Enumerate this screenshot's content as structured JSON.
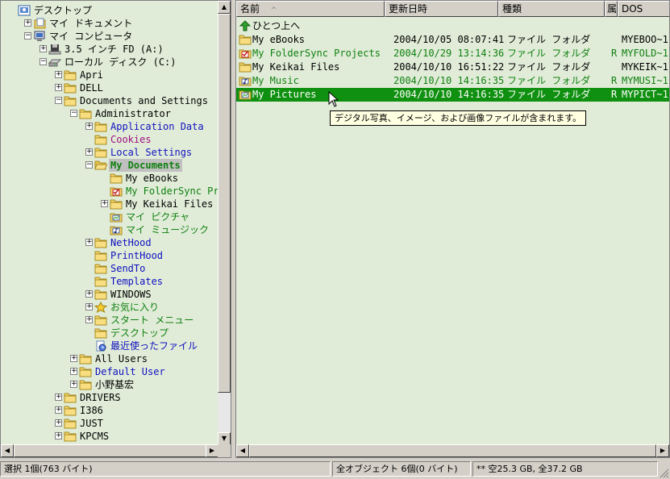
{
  "tree": {
    "items": [
      {
        "label": "デスクトップ",
        "depth": 0,
        "expander": "",
        "icon": "desktop-icon",
        "color": "black"
      },
      {
        "label": "マイ ドキュメント",
        "depth": 1,
        "expander": "+",
        "icon": "my-documents-icon",
        "color": "black"
      },
      {
        "label": "マイ コンピュータ",
        "depth": 1,
        "expander": "-",
        "icon": "my-computer-icon",
        "color": "black"
      },
      {
        "label": "3.5 インチ FD (A:)",
        "depth": 2,
        "expander": "+",
        "icon": "floppy-drive-icon",
        "color": "black"
      },
      {
        "label": "ローカル ディスク (C:)",
        "depth": 2,
        "expander": "-",
        "icon": "hard-disk-icon",
        "color": "black"
      },
      {
        "label": "Apri",
        "depth": 3,
        "expander": "+",
        "icon": "folder-icon",
        "color": "black"
      },
      {
        "label": "DELL",
        "depth": 3,
        "expander": "+",
        "icon": "folder-icon",
        "color": "black"
      },
      {
        "label": "Documents and Settings",
        "depth": 3,
        "expander": "-",
        "icon": "folder-icon",
        "color": "black"
      },
      {
        "label": "Administrator",
        "depth": 4,
        "expander": "-",
        "icon": "folder-icon",
        "color": "black"
      },
      {
        "label": "Application Data",
        "depth": 5,
        "expander": "+",
        "icon": "folder-icon",
        "color": "blue"
      },
      {
        "label": "Cookies",
        "depth": 5,
        "expander": "",
        "icon": "folder-icon",
        "color": "purple"
      },
      {
        "label": "Local Settings",
        "depth": 5,
        "expander": "+",
        "icon": "folder-icon",
        "color": "blue"
      },
      {
        "label": "My Documents",
        "depth": 5,
        "expander": "-",
        "icon": "open-folder-icon",
        "color": "green",
        "selected": true
      },
      {
        "label": "My eBooks",
        "depth": 6,
        "expander": "",
        "icon": "folder-icon",
        "color": "black"
      },
      {
        "label": "My FolderSync Projects",
        "depth": 6,
        "expander": "",
        "icon": "foldersync-folder-icon",
        "color": "green"
      },
      {
        "label": "My Keikai Files",
        "depth": 6,
        "expander": "+",
        "icon": "folder-icon",
        "color": "black"
      },
      {
        "label": "マイ ピクチャ",
        "depth": 6,
        "expander": "",
        "icon": "my-pictures-icon",
        "color": "green"
      },
      {
        "label": "マイ ミュージック",
        "depth": 6,
        "expander": "",
        "icon": "my-music-icon",
        "color": "green"
      },
      {
        "label": "NetHood",
        "depth": 5,
        "expander": "+",
        "icon": "folder-icon",
        "color": "blue"
      },
      {
        "label": "PrintHood",
        "depth": 5,
        "expander": "",
        "icon": "folder-icon",
        "color": "blue"
      },
      {
        "label": "SendTo",
        "depth": 5,
        "expander": "",
        "icon": "folder-icon",
        "color": "blue"
      },
      {
        "label": "Templates",
        "depth": 5,
        "expander": "",
        "icon": "folder-icon",
        "color": "blue"
      },
      {
        "label": "WINDOWS",
        "depth": 5,
        "expander": "+",
        "icon": "folder-icon",
        "color": "black"
      },
      {
        "label": "お気に入り",
        "depth": 5,
        "expander": "+",
        "icon": "favorites-star-icon",
        "color": "green"
      },
      {
        "label": "スタート メニュー",
        "depth": 5,
        "expander": "+",
        "icon": "folder-icon",
        "color": "green"
      },
      {
        "label": "デスクトップ",
        "depth": 5,
        "expander": "",
        "icon": "folder-icon",
        "color": "green"
      },
      {
        "label": "最近使ったファイル",
        "depth": 5,
        "expander": "",
        "icon": "recent-files-icon",
        "color": "blue"
      },
      {
        "label": "All Users",
        "depth": 4,
        "expander": "+",
        "icon": "folder-icon",
        "color": "black"
      },
      {
        "label": "Default User",
        "depth": 4,
        "expander": "+",
        "icon": "folder-icon",
        "color": "blue"
      },
      {
        "label": "小野基宏",
        "depth": 4,
        "expander": "+",
        "icon": "folder-icon",
        "color": "black"
      },
      {
        "label": "DRIVERS",
        "depth": 3,
        "expander": "+",
        "icon": "folder-icon",
        "color": "black"
      },
      {
        "label": "I386",
        "depth": 3,
        "expander": "+",
        "icon": "folder-icon",
        "color": "black"
      },
      {
        "label": "JUST",
        "depth": 3,
        "expander": "+",
        "icon": "folder-icon",
        "color": "black"
      },
      {
        "label": "KPCMS",
        "depth": 3,
        "expander": "+",
        "icon": "folder-icon",
        "color": "black"
      }
    ]
  },
  "list": {
    "columns": [
      "名前",
      "更新日時",
      "種類",
      "属",
      "DOS"
    ],
    "sort_indicator": "^",
    "rows": [
      {
        "name": "ひとつ上へ",
        "date": "",
        "type": "",
        "attr": "",
        "dos": "",
        "icon": "up-arrow-icon",
        "color": "black"
      },
      {
        "name": "My eBooks",
        "date": "2004/10/05 08:07:41",
        "type": "ファイル フォルダ",
        "attr": "",
        "dos": "MYEBOO~1",
        "icon": "folder-icon",
        "color": "black"
      },
      {
        "name": "My FolderSync Projects",
        "date": "2004/10/29 13:14:36",
        "type": "ファイル フォルダ",
        "attr": "R",
        "dos": "MYFOLD~1",
        "icon": "foldersync-folder-icon",
        "color": "green"
      },
      {
        "name": "My Keikai Files",
        "date": "2004/10/10 16:51:22",
        "type": "ファイル フォルダ",
        "attr": "",
        "dos": "MYKEIK~1",
        "icon": "folder-icon",
        "color": "black"
      },
      {
        "name": "My Music",
        "date": "2004/10/10 14:16:35",
        "type": "ファイル フォルダ",
        "attr": "R",
        "dos": "MYMUSI~1",
        "icon": "my-music-icon",
        "color": "green"
      },
      {
        "name": "My Pictures",
        "date": "2004/10/10 14:16:35",
        "type": "ファイル フォルダ",
        "attr": "R",
        "dos": "MYPICT~1",
        "icon": "my-pictures-icon",
        "color": "green",
        "selected": true
      }
    ]
  },
  "tooltip": "デジタル写真、イメージ、および画像ファイルが含まれます。",
  "status": {
    "selection": "選択 1個(763 バイト)",
    "total": "全オブジェクト 6個(0 バイト)",
    "disk": "** 空25.3 GB, 全37.2 GB"
  },
  "colors": {
    "pane_background": "#e0ecd8",
    "selection_green": "#109010",
    "text_blue": "#1010c0",
    "text_green": "#108010",
    "text_purple": "#a01080"
  }
}
